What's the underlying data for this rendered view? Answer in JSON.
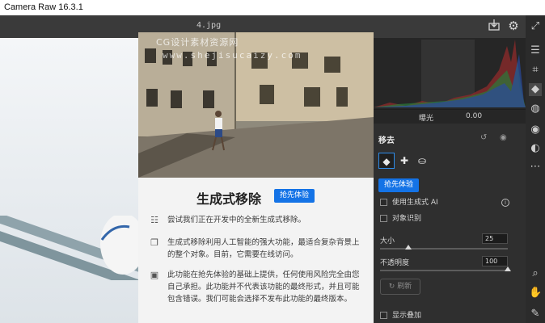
{
  "app": {
    "title": "Camera Raw 16.3.1"
  },
  "toolbar": {
    "filename": "4.jpg",
    "icons": [
      "save-icon",
      "settings-icon",
      "fullscreen-icon"
    ]
  },
  "right_tools": [
    "adjust-sliders-icon",
    "crop-icon",
    "eraser-icon",
    "mask-icon",
    "redeye-icon",
    "presets-icon",
    "more-icon",
    "zoom-icon",
    "hand-icon",
    "eyedropper-icon"
  ],
  "histogram": {
    "label": "曝光",
    "value": "0.00"
  },
  "remove_panel": {
    "title": "移去",
    "early_access": "抢先体验",
    "use_generative_ai": "使用生成式 AI",
    "object_detection": "对象识别",
    "size_label": "大小",
    "size_value": "25",
    "size_fraction": 0.22,
    "opacity_label": "不透明度",
    "opacity_value": "100",
    "opacity_fraction": 1.0,
    "refresh_label": "刷新",
    "show_overlay": "显示叠加"
  },
  "dialog": {
    "watermark_line1": "CG设计素材资源网",
    "watermark_line2": "www.shejisucaizy.com",
    "title": "生成式移除",
    "badge": "抢先体验",
    "items": [
      {
        "icon": "sliders-icon",
        "text": "尝试我们正在开发中的全新生成式移除。"
      },
      {
        "icon": "copy-icon",
        "text": "生成式移除利用人工智能的强大功能，最适合复杂背景上的整个对象。目前，它需要在线访问。"
      },
      {
        "icon": "chat-icon",
        "text": "此功能在抢先体验的基础上提供，任何使用风险完全由您自己承担。此功能并不代表该功能的最终形式，并且可能包含错误。我们可能会选择不发布此功能的最终版本。"
      }
    ]
  }
}
